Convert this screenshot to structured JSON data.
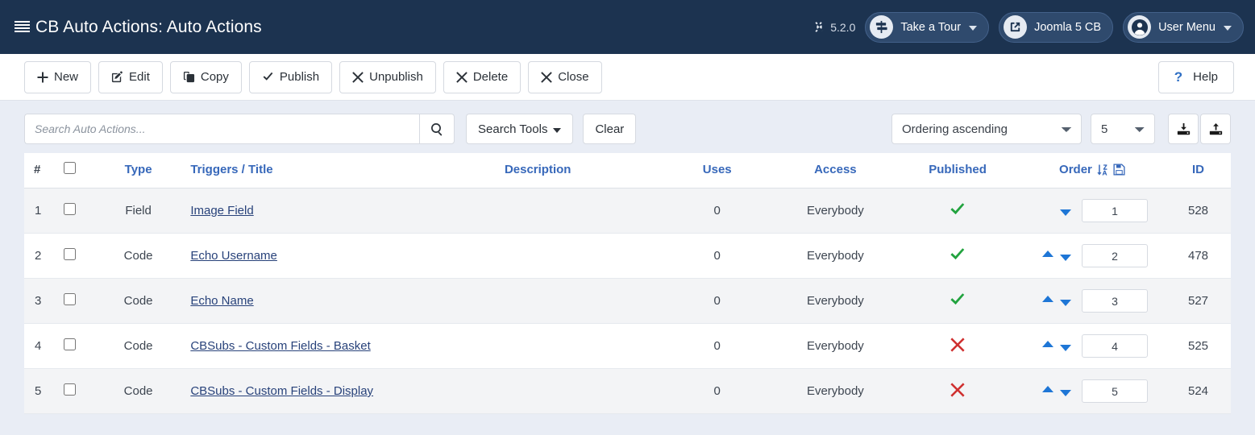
{
  "header": {
    "title": "CB Auto Actions: Auto Actions",
    "title_icon": "list-icon",
    "version_label": "5.2.0",
    "version_icon": "joomla-logo-icon",
    "buttons": [
      {
        "label": "Take a Tour",
        "icon": "signpost-icon",
        "caret": "chevron-down-icon"
      },
      {
        "label": "Joomla 5 CB",
        "icon": "external-link-icon",
        "caret": ""
      },
      {
        "label": "User Menu",
        "icon": "user-circle-icon",
        "caret": "chevron-down-icon"
      }
    ]
  },
  "toolbar": {
    "new_label": "New",
    "edit_label": "Edit",
    "copy_label": "Copy",
    "publish_label": "Publish",
    "unpublish_label": "Unpublish",
    "delete_label": "Delete",
    "close_label": "Close",
    "help_label": "Help",
    "new_icon": "plus-icon",
    "edit_icon": "pencil-square-icon",
    "copy_icon": "copy-icon",
    "publish_icon": "check-icon",
    "unpublish_icon": "times-icon",
    "delete_icon": "times-icon",
    "close_icon": "times-icon",
    "help_icon": "question-mark-icon"
  },
  "filters": {
    "search_placeholder": "Search Auto Actions...",
    "search_value": "",
    "search_icon": "magnifier-icon",
    "search_tools_label": "Search Tools",
    "search_tools_caret": "caret-down-icon",
    "clear_label": "Clear",
    "ordering_value": "Ordering ascending",
    "ordering_options": [
      "Ordering ascending"
    ],
    "limit_value": "5",
    "limit_options": [
      "5"
    ],
    "download_icon": "download-icon",
    "upload_icon": "upload-icon"
  },
  "table": {
    "columns": {
      "num": "#",
      "select_all": "select-all-checkbox",
      "type": "Type",
      "triggers": "Triggers / Title",
      "description": "Description",
      "uses": "Uses",
      "access": "Access",
      "published": "Published",
      "order": "Order",
      "order_sort_icon": "sort-alpha-down-icon",
      "order_save_icon": "save-icon",
      "id": "ID"
    },
    "rows": [
      {
        "num": "1",
        "type": "Field",
        "title": "Image Field",
        "description": "",
        "uses": "0",
        "access": "Everybody",
        "published": true,
        "published_icon": "check-icon",
        "order": "1",
        "can_move_up": false,
        "can_move_down": true,
        "id": "528"
      },
      {
        "num": "2",
        "type": "Code",
        "title": "Echo Username",
        "description": "",
        "uses": "0",
        "access": "Everybody",
        "published": true,
        "published_icon": "check-icon",
        "order": "2",
        "can_move_up": true,
        "can_move_down": true,
        "id": "478"
      },
      {
        "num": "3",
        "type": "Code",
        "title": "Echo Name",
        "description": "",
        "uses": "0",
        "access": "Everybody",
        "published": true,
        "published_icon": "check-icon",
        "order": "3",
        "can_move_up": true,
        "can_move_down": true,
        "id": "527"
      },
      {
        "num": "4",
        "type": "Code",
        "title": "CBSubs - Custom Fields - Basket",
        "description": "",
        "uses": "0",
        "access": "Everybody",
        "published": false,
        "published_icon": "times-icon",
        "order": "4",
        "can_move_up": true,
        "can_move_down": true,
        "id": "525"
      },
      {
        "num": "5",
        "type": "Code",
        "title": "CBSubs - Custom Fields - Display",
        "description": "",
        "uses": "0",
        "access": "Everybody",
        "published": false,
        "published_icon": "times-icon",
        "order": "5",
        "can_move_up": true,
        "can_move_down": true,
        "id": "524"
      }
    ]
  },
  "colors": {
    "header_bg": "#1c3350",
    "link": "#28427a",
    "column_header": "#3768ba",
    "published_yes": "#22a33f",
    "published_no": "#cf3030",
    "arrow": "#1e76d6",
    "page_bg": "#e9edf5"
  }
}
